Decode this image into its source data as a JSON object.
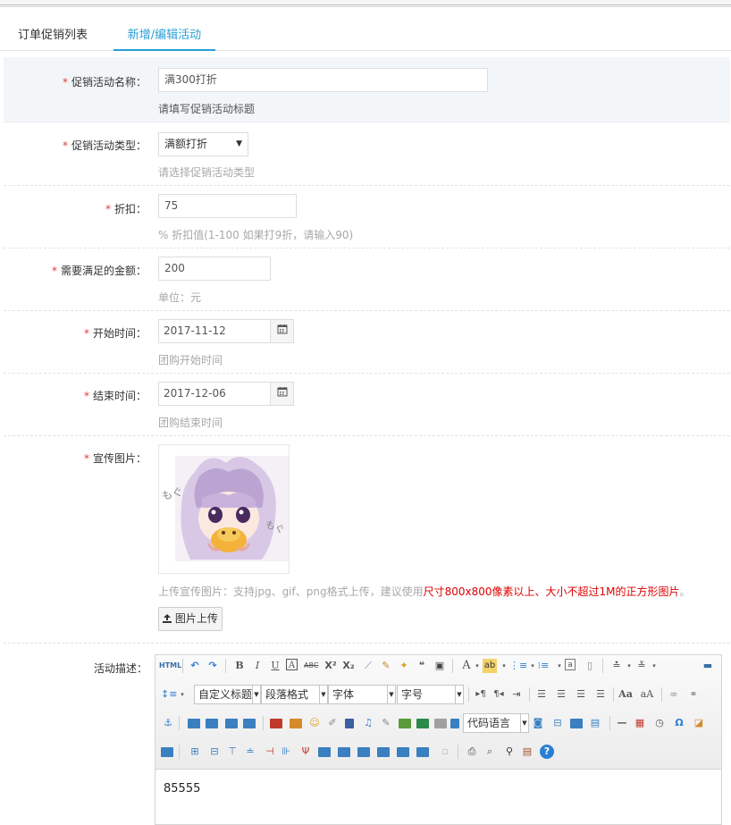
{
  "tabs": [
    {
      "label": "订单促销列表"
    },
    {
      "label": "新增/编辑活动"
    }
  ],
  "required_mark": "*",
  "form": {
    "name": {
      "label": "促销活动名称：",
      "value": "满300打折",
      "help": "请填写促销活动标题"
    },
    "type": {
      "label": "促销活动类型：",
      "value": "满额打折",
      "help": "请选择促销活动类型"
    },
    "discount": {
      "label": "折扣：",
      "value": "75",
      "help": "% 折扣值(1-100 如果打9折，请输入90)"
    },
    "amount": {
      "label": "需要满足的金额：",
      "value": "200",
      "help": "单位：元"
    },
    "start": {
      "label": "开始时间：",
      "value": "2017-11-12",
      "help": "团购开始时间"
    },
    "end": {
      "label": "结束时间：",
      "value": "2017-12-06",
      "help": "团购结束时间"
    },
    "image": {
      "label": "宣传图片：",
      "help_prefix": "上传宣传图片：支持jpg、gif、png格式上传，建议使用",
      "help_highlight": "尺寸800x800像素以上、大小不超过1M的正方形图片",
      "help_suffix": "。",
      "upload_label": "图片上传"
    },
    "desc": {
      "label": "活动描述：",
      "content": "85555"
    }
  },
  "editor": {
    "html_btn": "HTML",
    "combos": {
      "custom_title": "自定义标题",
      "paragraph": "段落格式",
      "font": "字体",
      "size": "字号",
      "code_lang": "代码语言"
    }
  },
  "colors": {
    "accent": "#2a9fd6",
    "required": "#e4393c",
    "highlight": "#d00"
  }
}
